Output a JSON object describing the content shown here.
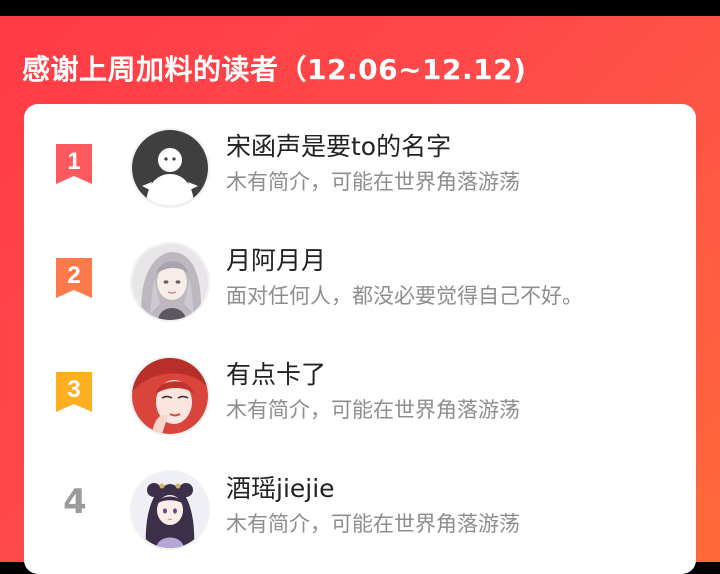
{
  "header": {
    "title": "感谢上周加料的读者（12.06~12.12)"
  },
  "colors": {
    "banner_start": "#ff3b45",
    "banner_end": "#ff6a3a",
    "rank1": "#ff5a5f",
    "rank2": "#ff7a4a",
    "rank3": "#ffb020",
    "rank_other": "#9b9b9b"
  },
  "readers": [
    {
      "rank": "1",
      "name": "宋函声是要to的名字",
      "bio": "木有简介，可能在世界角落游荡",
      "avatar": "default-avatar-icon"
    },
    {
      "rank": "2",
      "name": "月阿月月",
      "bio": "面对任何人，都没必要觉得自己不好。",
      "avatar": "silver-hair-girl-avatar"
    },
    {
      "rank": "3",
      "name": "有点卡了",
      "bio": "木有简介，可能在世界角落游荡",
      "avatar": "red-hair-girl-avatar"
    },
    {
      "rank": "4",
      "name": "酒瑶jiejie",
      "bio": "木有简介，可能在世界角落游荡",
      "avatar": "anime-girl-avatar"
    }
  ]
}
